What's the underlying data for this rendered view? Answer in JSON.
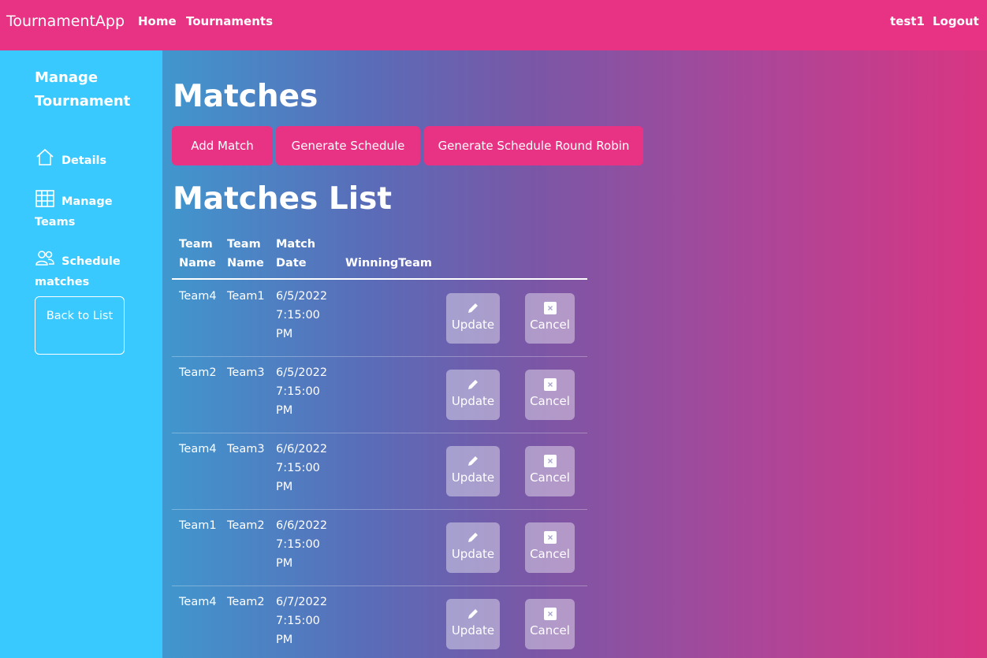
{
  "nav": {
    "brand": "TournamentApp",
    "links": [
      "Home",
      "Tournaments"
    ],
    "user": "test1",
    "logout": "Logout"
  },
  "sidebar": {
    "title": "Manage Tournament",
    "items": [
      {
        "label": "Details",
        "icon": "home-icon"
      },
      {
        "label": "Manage Teams",
        "icon": "table-icon"
      },
      {
        "label": "Schedule matches",
        "icon": "people-icon"
      }
    ],
    "back": "Back to List"
  },
  "main": {
    "title": "Matches",
    "buttons": [
      "Add Match",
      "Generate Schedule",
      "Generate Schedule Round Robin"
    ],
    "list_title": "Matches List"
  },
  "table": {
    "headers": [
      "Team Name",
      "Team Name",
      "Match Date",
      "WinningTeam"
    ],
    "rows": [
      {
        "team1": "Team4",
        "team2": "Team1",
        "date": "6/5/2022",
        "time": "7:15:00",
        "ampm": "PM",
        "winner": ""
      },
      {
        "team1": "Team2",
        "team2": "Team3",
        "date": "6/5/2022",
        "time": "7:15:00",
        "ampm": "PM",
        "winner": ""
      },
      {
        "team1": "Team4",
        "team2": "Team3",
        "date": "6/6/2022",
        "time": "7:15:00",
        "ampm": "PM",
        "winner": ""
      },
      {
        "team1": "Team1",
        "team2": "Team2",
        "date": "6/6/2022",
        "time": "7:15:00",
        "ampm": "PM",
        "winner": ""
      },
      {
        "team1": "Team4",
        "team2": "Team2",
        "date": "6/7/2022",
        "time": "7:15:00",
        "ampm": "PM",
        "winner": ""
      }
    ],
    "update_label": "Update",
    "cancel_label": "Cancel"
  },
  "colors": {
    "navbar": "#e83385",
    "sidebar": "#3ac9fe",
    "primary_button": "#e83385"
  }
}
